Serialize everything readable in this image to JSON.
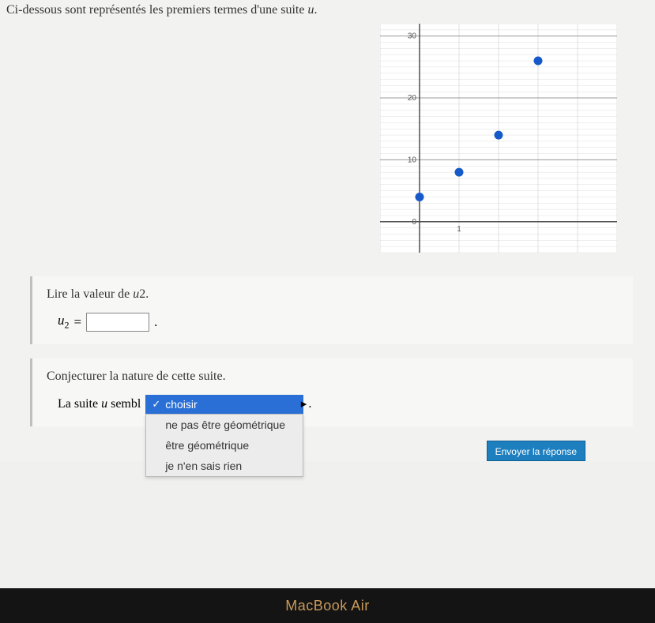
{
  "instruction_prefix": "Ci-dessous sont représentés les premiers termes d'une suite ",
  "instruction_var": "u",
  "instruction_suffix": ".",
  "chart_data": {
    "type": "scatter",
    "x": [
      0,
      1,
      2,
      3
    ],
    "y": [
      4,
      8,
      14,
      26
    ],
    "xlim": [
      -1,
      5
    ],
    "ylim": [
      -5,
      32
    ],
    "yticks": [
      0,
      10,
      20,
      30
    ],
    "xticks": [
      0,
      1
    ],
    "point_color": "#1659c9"
  },
  "q1": {
    "prompt_prefix": "Lire la valeur de ",
    "prompt_var": "u",
    "prompt_sub": "2",
    "prompt_suffix": ".",
    "eq_var": "u",
    "eq_sub": "2",
    "eq_op": "=",
    "value": "",
    "trail": "."
  },
  "q2": {
    "prompt": "Conjecturer la nature de cette suite.",
    "lead_prefix": "La suite ",
    "lead_var": "u",
    "lead_suffix": " sembl",
    "trail": ".",
    "selected": "choisir",
    "options": [
      "ne pas être géométrique",
      "être géométrique",
      "je n'en sais rien"
    ]
  },
  "submit_label": "Envoyer la réponse",
  "device_label": "MacBook Air"
}
